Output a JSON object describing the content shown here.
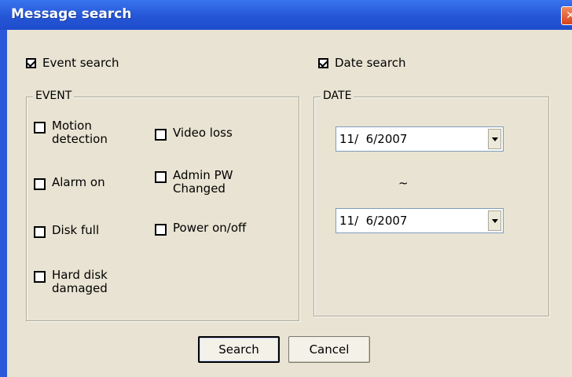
{
  "window": {
    "title": "Message search",
    "close_icon": "close-icon"
  },
  "event_search": {
    "label": "Event search",
    "checked": true
  },
  "date_search": {
    "label": "Date search",
    "checked": true
  },
  "event_group": {
    "title": "EVENT",
    "items": [
      {
        "label": "Motion\ndetection",
        "checked": false
      },
      {
        "label": "Video loss",
        "checked": false
      },
      {
        "label": "Alarm on",
        "checked": false
      },
      {
        "label": "Admin PW\nChanged",
        "checked": false
      },
      {
        "label": "Disk full",
        "checked": false
      },
      {
        "label": "Power on/off",
        "checked": false
      },
      {
        "label": "Hard disk\ndamaged",
        "checked": false
      }
    ]
  },
  "date_group": {
    "title": "DATE",
    "from": "11/  6/2007",
    "separator": "~",
    "to": "11/  6/2007"
  },
  "buttons": {
    "search": "Search",
    "cancel": "Cancel"
  }
}
